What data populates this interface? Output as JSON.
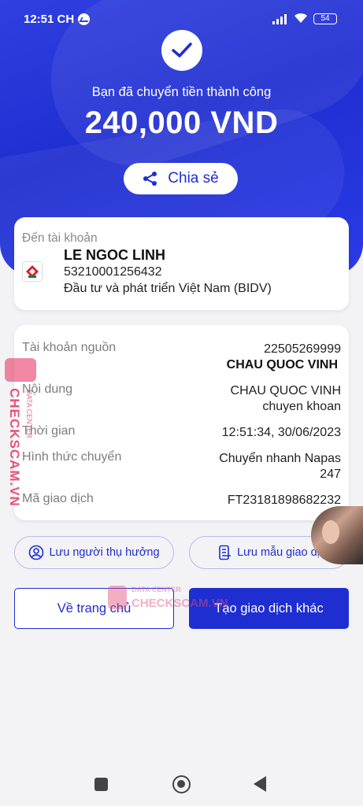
{
  "status_bar": {
    "time": "12:51 CH",
    "battery": "54"
  },
  "hero": {
    "success_text": "Bạn đã chuyển tiền thành công",
    "amount": "240,000 VND",
    "share_label": "Chia sẻ"
  },
  "recipient": {
    "label": "Đến tài khoản",
    "name": "LE NGOC LINH",
    "account_number": "53210001256432",
    "bank": "Đầu tư và phát triển Việt Nam (BIDV)"
  },
  "details": [
    {
      "label": "Tài khoản nguồn",
      "value_lines": [
        "22505269999"
      ],
      "value_bold": "CHAU QUOC VINH"
    },
    {
      "label": "Nội dung",
      "value_lines": [
        "CHAU QUOC VINH",
        "chuyen khoan"
      ]
    },
    {
      "label": "Thời gian",
      "value_lines": [
        "12:51:34, 30/06/2023"
      ]
    },
    {
      "label": "Hình thức chuyển",
      "value_lines": [
        "Chuyển nhanh Napas",
        "247"
      ]
    },
    {
      "label": "Mã giao dịch",
      "value_lines": [
        "FT23181898682232"
      ]
    }
  ],
  "actions": {
    "save_beneficiary": "Lưu người thụ hưởng",
    "save_template": "Lưu mẫu giao dị",
    "home": "Về trang chủ",
    "new_transaction": "Tạo giao dịch khác"
  },
  "watermark": {
    "side_text": "CHECKSCAM.VN",
    "side_sub": "DATA CENTER",
    "center_top": "DATA CENTER",
    "center_main": "CHECKSCAM.VN"
  },
  "colors": {
    "primary": "#1f2ed0",
    "hero_bg": "#2f3fe0",
    "watermark": "#e4507a"
  }
}
